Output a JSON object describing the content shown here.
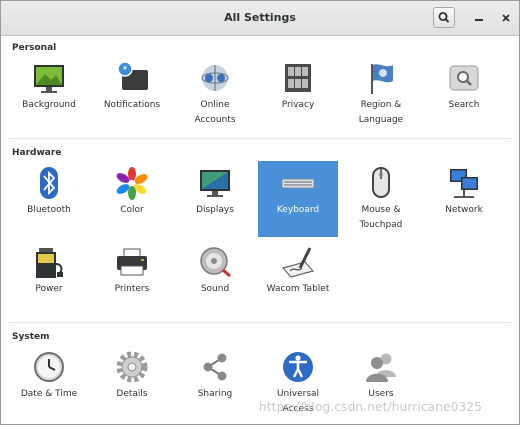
{
  "window": {
    "title": "All Settings"
  },
  "sections": {
    "personal": "Personal",
    "hardware": "Hardware",
    "system": "System"
  },
  "tiles": {
    "background": "Background",
    "notifications": "Notifications",
    "online_accounts": "Online\nAccounts",
    "privacy": "Privacy",
    "region_language": "Region &\nLanguage",
    "search": "Search",
    "bluetooth": "Bluetooth",
    "color": "Color",
    "displays": "Displays",
    "keyboard": "Keyboard",
    "mouse_touchpad": "Mouse &\nTouchpad",
    "network": "Network",
    "power": "Power",
    "printers": "Printers",
    "sound": "Sound",
    "wacom_tablet": "Wacom Tablet",
    "date_time": "Date & Time",
    "details": "Details",
    "sharing": "Sharing",
    "universal_access": "Universal\nAccess",
    "users": "Users"
  },
  "selected_tile": "keyboard",
  "colors": {
    "selection": "#4a90d9"
  },
  "watermark": "https://blog.csdn.net/hurricane0325"
}
